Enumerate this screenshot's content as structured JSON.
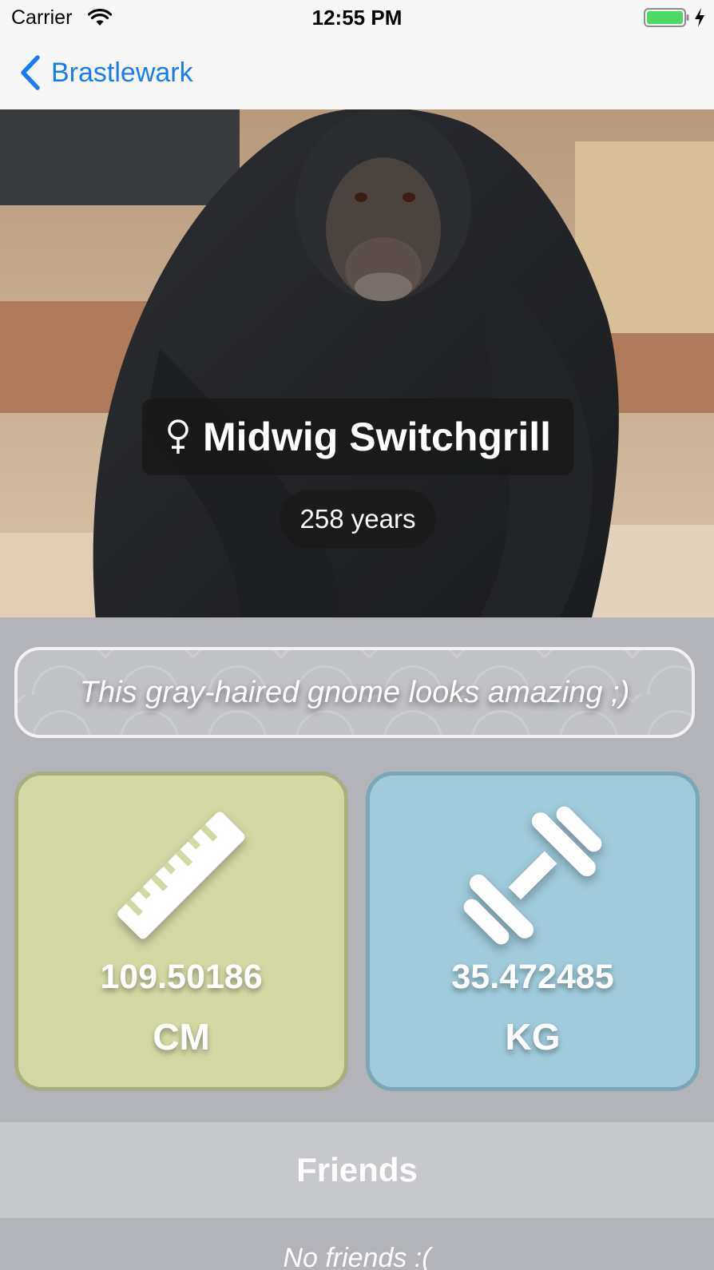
{
  "status_bar": {
    "carrier": "Carrier",
    "time": "12:55 PM",
    "icons": [
      "wifi-icon",
      "battery-icon",
      "charging-icon"
    ],
    "battery_color": "#4cd964"
  },
  "nav": {
    "back_label": "Brastlewark",
    "back_icon": "chevron-left-icon",
    "tint_color": "#1a7cf5"
  },
  "profile": {
    "photo": "chimpanzee-photo",
    "gender_icon": "female-symbol-icon",
    "name": "Midwig Switchgrill",
    "age": "258 years",
    "description": "This gray-haired gnome looks amazing ;)"
  },
  "stats": {
    "height": {
      "icon": "ruler-icon",
      "value": "109.50186",
      "unit": "CM",
      "background": "#d4d9a4",
      "border": "#a9ae80"
    },
    "weight": {
      "icon": "dumbbell-icon",
      "value": "35.472485",
      "unit": "KG",
      "background": "#9fcbdb",
      "border": "#7aa7b7"
    }
  },
  "friends": {
    "title": "Friends",
    "empty_text": "No friends :("
  }
}
